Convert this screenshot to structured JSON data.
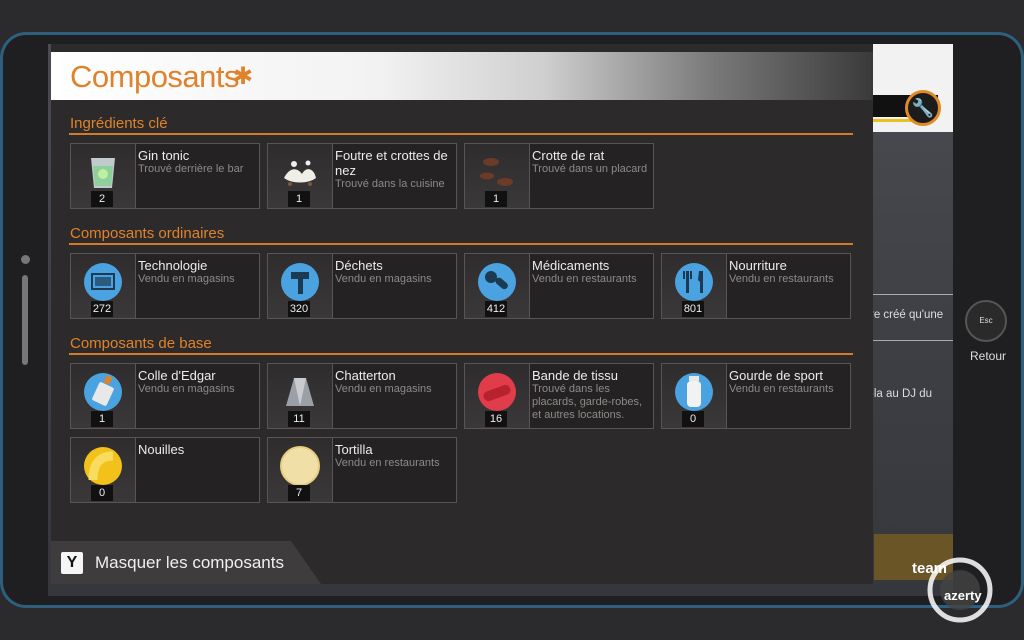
{
  "panel": {
    "title": "Composants",
    "puzzle_icon": "puzzle-icon"
  },
  "sections": [
    {
      "title": "Ingrédients clé",
      "items": [
        {
          "name": "Gin tonic",
          "desc": "Trouvé derrière le bar",
          "count": "2",
          "icon": "gin-tonic-icon"
        },
        {
          "name": "Foutre et crottes de nez",
          "desc": "Trouvé dans la cuisine",
          "count": "1",
          "icon": "foutre-icon"
        },
        {
          "name": "Crotte de rat",
          "desc": "Trouvé dans un placard",
          "count": "1",
          "icon": "rat-droppings-icon"
        }
      ]
    },
    {
      "title": "Composants ordinaires",
      "items": [
        {
          "name": "Technologie",
          "desc": "Vendu en magasins",
          "count": "272",
          "icon": "technology-icon"
        },
        {
          "name": "Déchets",
          "desc": "Vendu en magasins",
          "count": "320",
          "icon": "hammer-icon"
        },
        {
          "name": "Médicaments",
          "desc": "Vendu en restaurants",
          "count": "412",
          "icon": "pills-icon"
        },
        {
          "name": "Nourriture",
          "desc": "Vendu en restaurants",
          "count": "801",
          "icon": "fork-knife-icon"
        }
      ]
    },
    {
      "title": "Composants de base",
      "items": [
        {
          "name": "Colle d'Edgar",
          "desc": "Vendu en magasins",
          "count": "1",
          "icon": "glue-icon"
        },
        {
          "name": "Chatterton",
          "desc": "Vendu en magasins",
          "count": "11",
          "icon": "tape-icon"
        },
        {
          "name": "Bande de tissu",
          "desc": "Trouvé dans les placards, garde-robes, et autres locations.",
          "count": "16",
          "icon": "cloth-icon"
        },
        {
          "name": "Gourde de sport",
          "desc": "Vendu en restaurants",
          "count": "0",
          "icon": "bottle-icon"
        },
        {
          "name": "Nouilles",
          "desc": "",
          "count": "0",
          "icon": "noodle-icon"
        },
        {
          "name": "Tortilla",
          "desc": "Vendu en restaurants",
          "count": "7",
          "icon": "tortilla-icon"
        }
      ]
    }
  ],
  "bottom": {
    "key": "Y",
    "label": "Masquer les composants"
  },
  "esc": {
    "key": "Esc",
    "label": "Retour"
  },
  "background": {
    "text1": "re créé qu'une",
    "text2": "-la au DJ du"
  },
  "watermark": {
    "line1": "team",
    "line2": "azerty"
  },
  "colors": {
    "accent": "#e0822b",
    "panel": "#2c2a2b",
    "card": "#242222",
    "icon_blue": "#4aa3e0"
  }
}
